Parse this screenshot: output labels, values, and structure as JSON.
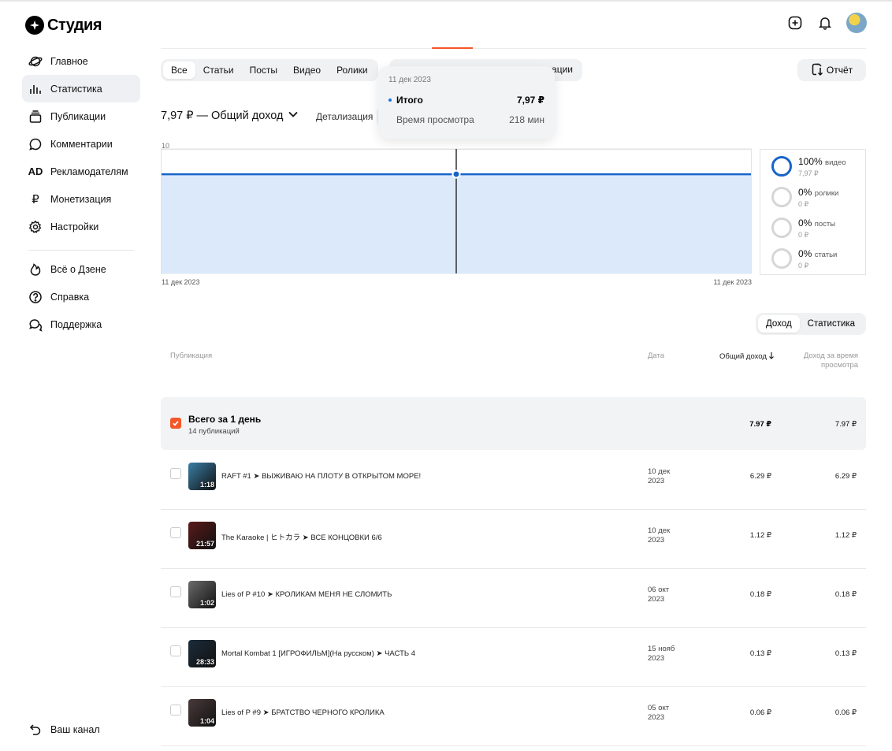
{
  "app": {
    "logo_text": "Студия"
  },
  "sidebar": {
    "items": [
      {
        "label": "Главное",
        "icon": "planet-icon"
      },
      {
        "label": "Статистика",
        "icon": "bar-chart-icon",
        "active": true
      },
      {
        "label": "Публикации",
        "icon": "stack-icon"
      },
      {
        "label": "Комментарии",
        "icon": "comment-icon"
      },
      {
        "label": "Рекламодателям",
        "icon": "ad-icon"
      },
      {
        "label": "Монетизация",
        "icon": "ruble-icon"
      },
      {
        "label": "Настройки",
        "icon": "gear-icon"
      }
    ],
    "secondary": [
      {
        "label": "Всё о Дзене",
        "icon": "flame-icon"
      },
      {
        "label": "Справка",
        "icon": "help-icon"
      },
      {
        "label": "Поддержка",
        "icon": "support-icon"
      }
    ],
    "bottom": {
      "label": "Ваш канал",
      "icon": "back-arrow-icon"
    }
  },
  "filters": {
    "tabs": [
      "Все",
      "Статьи",
      "Посты",
      "Видео",
      "Ролики"
    ],
    "second_group_visible_text": "ации",
    "report_label": "Отчёт"
  },
  "income": {
    "title": "7,97 ₽ — Общий доход",
    "detail_label": "Детализация"
  },
  "tooltip": {
    "date": "11 дек 2023",
    "total_label": "Итого",
    "total_value": "7,97 ₽",
    "watch_label": "Время просмотра",
    "watch_value": "218 мин"
  },
  "chart_data": {
    "type": "area",
    "x": [
      "11 дек 2023",
      "11 дек 2023"
    ],
    "series": [
      {
        "values": [
          7.97,
          7.97
        ]
      }
    ],
    "y_ticks": [
      "10",
      "5",
      "0"
    ],
    "ylim": [
      0,
      10
    ],
    "x_tick_labels": [
      "11 дек 2023",
      "11 дек 2023"
    ],
    "colors": {
      "line": "#1764c9",
      "fill": "#dbe9fb"
    }
  },
  "legend": [
    {
      "percent": "100%",
      "name": "видео",
      "amount": "7,97 ₽",
      "full": true
    },
    {
      "percent": "0%",
      "name": "ролики",
      "amount": "0 ₽",
      "full": false
    },
    {
      "percent": "0%",
      "name": "посты",
      "amount": "0 ₽",
      "full": false
    },
    {
      "percent": "0%",
      "name": "статьи",
      "amount": "0 ₽",
      "full": false
    }
  ],
  "view_toggle": {
    "income": "Доход",
    "stats": "Статистика"
  },
  "table": {
    "headers": {
      "publication": "Публикация",
      "date": "Дата",
      "total_income": "Общий доход",
      "watch_income": "Доход за время просмотра"
    },
    "total": {
      "title": "Всего за 1 день",
      "subtitle": "14 публикаций",
      "total_income": "7.97 ₽",
      "watch_income": "7.97 ₽"
    },
    "rows": [
      {
        "title": "RAFT #1 ➤ ВЫЖИВАЮ НА ПЛОТУ В ОТКРЫТОМ МОРЕ!",
        "duration": "1:18",
        "date": "10 дек 2023",
        "total_income": "6.29 ₽",
        "watch_income": "6.29 ₽",
        "thumb": "#3a7fa6"
      },
      {
        "title": "The Karaoke | ヒトカラ ➤ ВСЕ КОНЦОВКИ 6/6",
        "duration": "21:57",
        "date": "10 дек 2023",
        "total_income": "1.12 ₽",
        "watch_income": "1.12 ₽",
        "thumb": "#5a1a1a"
      },
      {
        "title": "Lies of P #10 ➤ КРОЛИКАМ МЕНЯ НЕ СЛОМИТЬ",
        "duration": "1:02",
        "date": "06 окт 2023",
        "total_income": "0.18 ₽",
        "watch_income": "0.18 ₽",
        "thumb": "#6b6b6b"
      },
      {
        "title": "Mortal Kombat 1 [ИГРОФИЛЬМ](На русском) ➤ ЧАСТЬ 4",
        "duration": "28:33",
        "date": "15 нояб 2023",
        "total_income": "0.13 ₽",
        "watch_income": "0.13 ₽",
        "thumb": "#1b2c3a"
      },
      {
        "title": "Lies of P #9 ➤ БРАТСТВО ЧЕРНОГО КРОЛИКА",
        "duration": "1:04",
        "date": "05 окт 2023",
        "total_income": "0.06 ₽",
        "watch_income": "0.06 ₽",
        "thumb": "#4a3a3a"
      }
    ]
  }
}
